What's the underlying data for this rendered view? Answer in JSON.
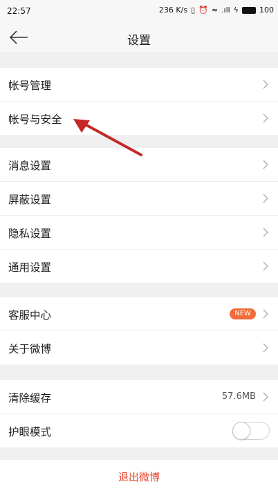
{
  "status": {
    "time": "22:57",
    "speed": "236 K/s",
    "battery": "100"
  },
  "header": {
    "title": "设置"
  },
  "groups": [
    {
      "items": [
        {
          "label": "帐号管理"
        },
        {
          "label": "帐号与安全"
        }
      ]
    },
    {
      "items": [
        {
          "label": "消息设置"
        },
        {
          "label": "屏蔽设置"
        },
        {
          "label": "隐私设置"
        },
        {
          "label": "通用设置"
        }
      ]
    },
    {
      "items": [
        {
          "label": "客服中心",
          "badge": "NEW"
        },
        {
          "label": "关于微博"
        }
      ]
    },
    {
      "items": [
        {
          "label": "清除缓存",
          "value": "57.6MB"
        },
        {
          "label": "护眼模式",
          "toggle": false
        }
      ]
    }
  ],
  "logout": {
    "label": "退出微博"
  },
  "colors": {
    "accent": "#e8442c",
    "badge": "#f26b3b",
    "annotation_arrow": "#c62828"
  }
}
